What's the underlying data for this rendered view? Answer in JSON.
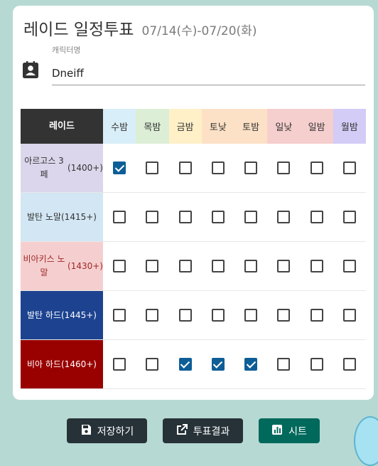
{
  "header": {
    "title": "레이드 일정투표",
    "date_range": "07/14(수)-07/20(화)"
  },
  "character": {
    "label": "캐릭터명",
    "value": "Dneiff"
  },
  "table": {
    "raid_header": "레이드",
    "days": [
      {
        "label": "수밤",
        "color": "#d8eef8"
      },
      {
        "label": "목밤",
        "color": "#dcefd6"
      },
      {
        "label": "금밤",
        "color": "#fff0c8"
      },
      {
        "label": "토낮",
        "color": "#fde1c6"
      },
      {
        "label": "토밤",
        "color": "#fde1c6"
      },
      {
        "label": "일낮",
        "color": "#f5cece"
      },
      {
        "label": "일밤",
        "color": "#f5cece"
      },
      {
        "label": "월밤",
        "color": "#d3ccf7"
      }
    ],
    "raids": [
      {
        "name": "아르고스 3페",
        "level": "(1400+)",
        "bg": "#dcd6ec",
        "fg": "#333333",
        "checks": [
          true,
          false,
          false,
          false,
          false,
          false,
          false,
          false
        ]
      },
      {
        "name": "발탄 노말",
        "level": "(1415+)",
        "bg": "#d2e6f4",
        "fg": "#333333",
        "checks": [
          false,
          false,
          false,
          false,
          false,
          false,
          false,
          false
        ]
      },
      {
        "name": "비아키스 노말",
        "level": "(1430+)",
        "bg": "#f5cfcf",
        "fg": "#a02828",
        "checks": [
          false,
          false,
          false,
          false,
          false,
          false,
          false,
          false
        ]
      },
      {
        "name": "발탄 하드",
        "level": "(1445+)",
        "bg": "#1d4390",
        "fg": "#ffffff",
        "checks": [
          false,
          false,
          false,
          false,
          false,
          false,
          false,
          false
        ]
      },
      {
        "name": "비아 하드",
        "level": "(1460+)",
        "bg": "#990000",
        "fg": "#ffffff",
        "checks": [
          false,
          false,
          true,
          true,
          true,
          false,
          false,
          false
        ]
      }
    ]
  },
  "buttons": {
    "save": {
      "label": "저장하기",
      "icon": "save-icon"
    },
    "results": {
      "label": "투표결과",
      "icon": "open-external-icon"
    },
    "sheet": {
      "label": "시트",
      "icon": "chart-icon"
    }
  },
  "colors": {
    "accent": "#0d5e96",
    "background": "#b7d9d3",
    "dark_button": "#263238",
    "teal_button": "#00695c"
  }
}
